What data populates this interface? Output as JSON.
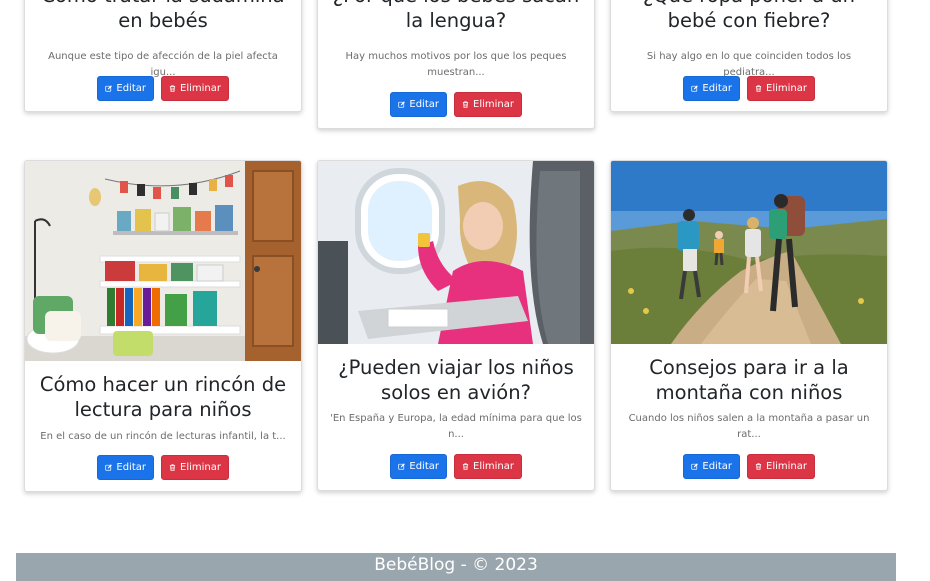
{
  "buttons": {
    "edit_label": "Editar",
    "delete_label": "Eliminar"
  },
  "icons": {
    "edit": "pencil-square-icon",
    "delete": "trash-icon"
  },
  "colors": {
    "edit": "#1a73e8",
    "delete": "#dc3545",
    "footer": "#9aa6ad"
  },
  "posts": [
    {
      "title": "Cómo tratar la sudamina en bebés",
      "excerpt": "Aunque este tipo de afección de la piel afecta igu..."
    },
    {
      "title": "¿Por qué los bebés sacan la lengua?",
      "excerpt": "Hay muchos motivos por los que los peques muestran..."
    },
    {
      "title": "¿Qué ropa poner a un bebé con fiebre?",
      "excerpt": "Si hay algo en lo que coinciden todos los pediatra..."
    },
    {
      "title": "Cómo hacer un rincón de lectura para niños",
      "excerpt": "En el caso de un rincón de lecturas infantil, la t..."
    },
    {
      "title": "¿Pueden viajar los niños solos en avión?",
      "excerpt": "'En España y Europa, la edad mínima para que los n..."
    },
    {
      "title": "Consejos para ir a la montaña con niños",
      "excerpt": "Cuando los niños salen a la montaña a pasar un rat..."
    }
  ],
  "footer": {
    "text": "BebéBlog - © 2023"
  }
}
